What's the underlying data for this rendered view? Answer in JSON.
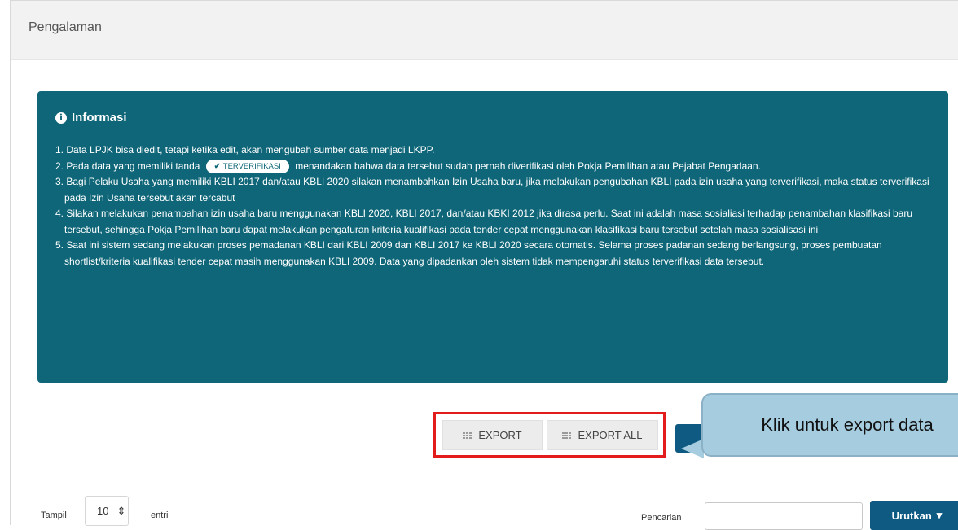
{
  "panel": {
    "title": "Pengalaman"
  },
  "info": {
    "heading": "Informasi",
    "items": [
      "1. Data LPJK bisa diedit, tetapi ketika edit, akan mengubah sumber data menjadi LKPP.",
      "2. Pada data yang memiliki tanda",
      "menandakan bahwa data tersebut sudah pernah diverifikasi oleh Pokja Pemilihan atau Pejabat Pengadaan.",
      "3. Bagi Pelaku Usaha yang memiliki KBLI 2017 dan/atau KBLI 2020 silakan menambahkan Izin Usaha baru, jika melakukan pengubahan KBLI pada izin usaha yang terverifikasi, maka status terverifikasi pada Izin Usaha tersebut akan tercabut",
      "4. Silakan melakukan penambahan izin usaha baru menggunakan KBLI 2020, KBLI 2017, dan/atau KBKI 2012 jika dirasa perlu. Saat ini adalah masa sosialiasi terhadap penambahan klasifikasi baru tersebut, sehingga Pokja Pemilihan baru dapat melakukan pengaturan kriteria kualifikasi pada tender cepat menggunakan klasifikasi baru tersebut setelah masa sosialisasi ini",
      "5. Saat ini sistem sedang melakukan proses pemadanan KBLI dari KBLI 2009 dan KBLI 2017 ke KBLI 2020 secara otomatis. Selama proses padanan sedang berlangsung, proses pembuatan shortlist/kriteria kualifikasi tender cepat masih menggunakan KBLI 2009. Data yang dipadankan oleh sistem tidak mempengaruhi status terverifikasi data tersebut."
    ],
    "badge": "TERVERIFIKASI"
  },
  "toolbar": {
    "export_label": "EXPORT",
    "export_all_label": "EXPORT ALL"
  },
  "callout": {
    "text": "Klik untuk export data"
  },
  "table_controls": {
    "show_label": "Tampil",
    "page_size": "10",
    "entries_label": "entri",
    "search_label": "Pencarian",
    "search_value": "",
    "sort_label": "Urutkan"
  },
  "colors": {
    "info_bg": "#0e6678",
    "accent": "#0e5a82",
    "highlight": "#e21b1b",
    "callout_bg": "#a6ccdf"
  }
}
